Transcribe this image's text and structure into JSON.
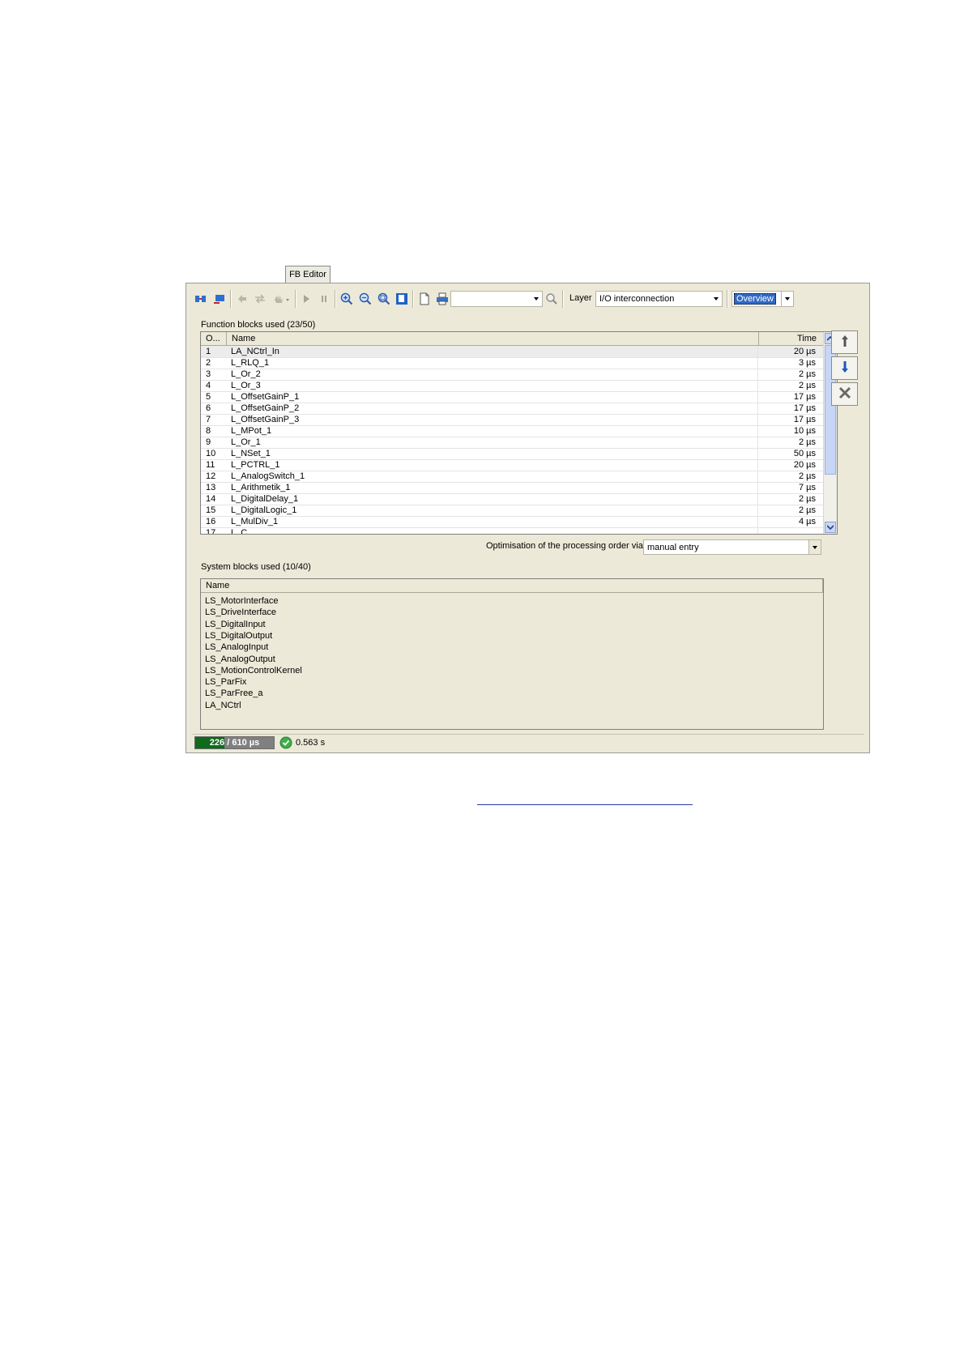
{
  "tab": {
    "label": "FB Editor"
  },
  "toolbar": {
    "icons": [
      "fb-connect-icon",
      "fb-insert-icon",
      "undo-icon",
      "redo-icon",
      "hand-icon",
      "play-icon",
      "pause-icon",
      "zoom-in-icon",
      "zoom-out-icon",
      "zoom-fit-icon",
      "page-icon",
      "new-page-icon",
      "print-icon",
      "search-icon"
    ],
    "search_combo_value": "",
    "layer_label": "Layer",
    "layer_value": "I/O interconnection",
    "view_value": "Overview"
  },
  "function_blocks": {
    "title": "Function blocks used (23/50)",
    "columns": [
      "O...",
      "Name",
      "Time"
    ],
    "rows": [
      {
        "order": "1",
        "name": "LA_NCtrl_In",
        "time": "20 µs"
      },
      {
        "order": "2",
        "name": "L_RLQ_1",
        "time": "3 µs"
      },
      {
        "order": "3",
        "name": "L_Or_2",
        "time": "2 µs"
      },
      {
        "order": "4",
        "name": "L_Or_3",
        "time": "2 µs"
      },
      {
        "order": "5",
        "name": "L_OffsetGainP_1",
        "time": "17 µs"
      },
      {
        "order": "6",
        "name": "L_OffsetGainP_2",
        "time": "17 µs"
      },
      {
        "order": "7",
        "name": "L_OffsetGainP_3",
        "time": "17 µs"
      },
      {
        "order": "8",
        "name": "L_MPot_1",
        "time": "10 µs"
      },
      {
        "order": "9",
        "name": "L_Or_1",
        "time": "2 µs"
      },
      {
        "order": "10",
        "name": "L_NSet_1",
        "time": "50 µs"
      },
      {
        "order": "11",
        "name": "L_PCTRL_1",
        "time": "20 µs"
      },
      {
        "order": "12",
        "name": "L_AnalogSwitch_1",
        "time": "2 µs"
      },
      {
        "order": "13",
        "name": "L_Arithmetik_1",
        "time": "7 µs"
      },
      {
        "order": "14",
        "name": "L_DigitalDelay_1",
        "time": "2 µs"
      },
      {
        "order": "15",
        "name": "L_DigitalLogic_1",
        "time": "2 µs"
      },
      {
        "order": "16",
        "name": "L_MulDiv_1",
        "time": "4 µs"
      },
      {
        "order": "17",
        "name": "L_C...",
        "time": ""
      }
    ]
  },
  "optimisation": {
    "label": "Optimisation of the processing order via",
    "value": "manual entry"
  },
  "system_blocks": {
    "title": "System blocks used (10/40)",
    "column": "Name",
    "items": [
      "LS_MotorInterface",
      "LS_DriveInterface",
      "LS_DigitalInput",
      "LS_DigitalOutput",
      "LS_AnalogInput",
      "LS_AnalogOutput",
      "LS_MotionControlKernel",
      "LS_ParFix",
      "LS_ParFree_a",
      "LA_NCtrl"
    ]
  },
  "status": {
    "used": "226",
    "total": "610 µs",
    "fraction": 0.37,
    "duration": "0.563 s"
  },
  "colors": {
    "window_bg": "#ece9d8",
    "progress_fill": "#0e6a1c",
    "selection": "#316ac5",
    "link": "#2a3aa5"
  }
}
